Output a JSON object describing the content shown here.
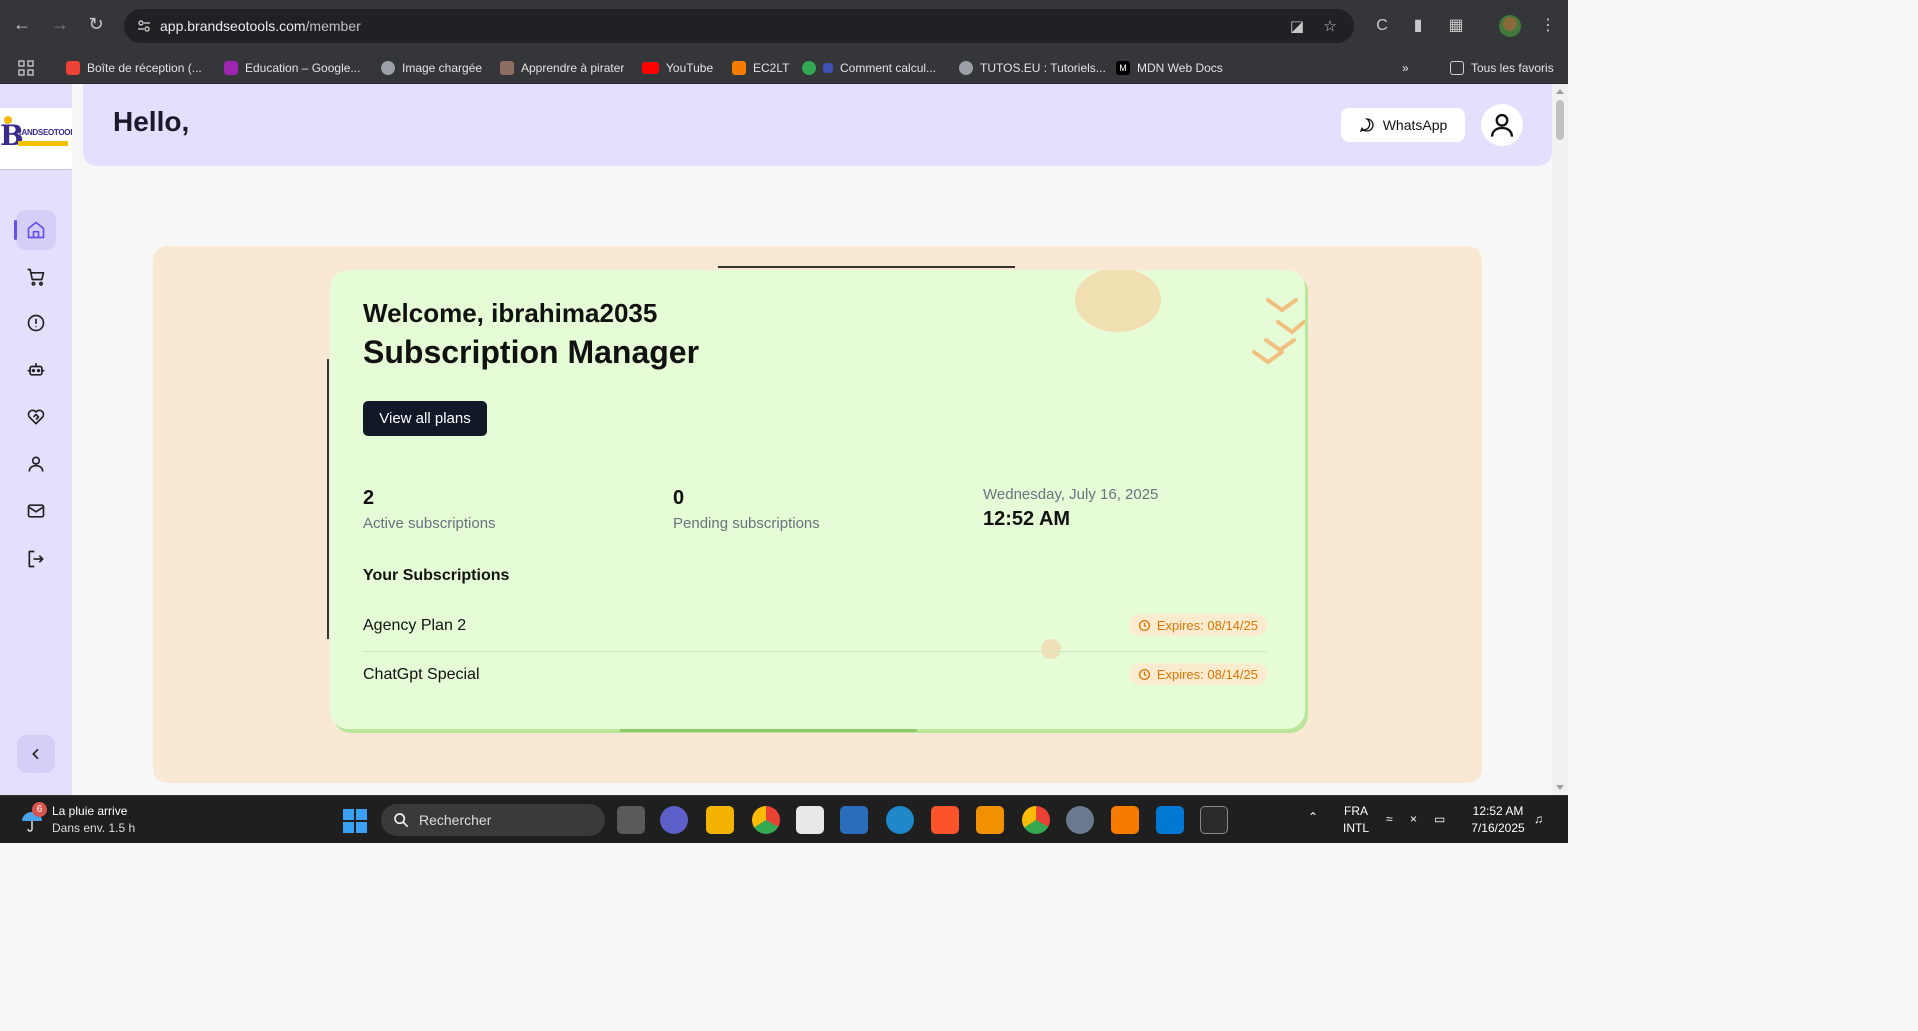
{
  "browser": {
    "url_host": "app.brandseotools.com",
    "url_path": "/member",
    "bookmarks": [
      {
        "label": "Boîte de réception (...",
        "color": "#ea4335"
      },
      {
        "label": "Education – Google...",
        "color": "#9c27b0"
      },
      {
        "label": "Image chargée",
        "color": "#9aa0a6"
      },
      {
        "label": "Apprendre à pirater",
        "color": "#8d6e63"
      },
      {
        "label": "YouTube",
        "color": "#ff0000"
      },
      {
        "label": "EC2LT",
        "color": "#f57c00"
      },
      {
        "label": "Comment calcul...",
        "color": "#3f51b5"
      },
      {
        "label": "TUTOS.EU : Tutoriels...",
        "color": "#9aa0a6"
      },
      {
        "label": "MDN Web Docs",
        "color": "#000000"
      }
    ],
    "all_bookmarks_label": "Tous les favoris"
  },
  "sidebar": {
    "logo_letter": "B",
    "logo_text": "RANDSEOTOOLS",
    "items": [
      "home-icon",
      "cart-icon",
      "alert-icon",
      "robot-icon",
      "heart-handshake-icon",
      "user-icon",
      "mail-icon",
      "logout-icon"
    ]
  },
  "header": {
    "greeting": "Hello,",
    "whatsapp_label": "WhatsApp"
  },
  "dashboard": {
    "welcome": "Welcome, ibrahima2035",
    "title": "Subscription Manager",
    "view_plans_label": "View all plans",
    "stats": {
      "active_count": "2",
      "active_label": "Active subscriptions",
      "pending_count": "0",
      "pending_label": "Pending subscriptions"
    },
    "date": "Wednesday, July 16, 2025",
    "time": "12:52 AM",
    "subscriptions_heading": "Your Subscriptions",
    "subscriptions": [
      {
        "name": "Agency Plan 2",
        "expires": "Expires: 08/14/25"
      },
      {
        "name": "ChatGpt Special",
        "expires": "Expires: 08/14/25"
      }
    ]
  },
  "taskbar": {
    "weather_badge": "6",
    "weather_title": "La pluie arrive",
    "weather_sub": "Dans env. 1.5 h",
    "search_placeholder": "Rechercher",
    "lang_top": "FRA",
    "lang_bottom": "INTL",
    "clock_time": "12:52 AM",
    "clock_date": "7/16/2025"
  },
  "colors": {
    "accent": "#6a4ee8",
    "sidebar_bg": "#e3dffd",
    "outer_card": "#f8e8d4",
    "inner_card": "#e6fcd6",
    "button_dark": "#111827",
    "expires_text": "#d97706"
  }
}
